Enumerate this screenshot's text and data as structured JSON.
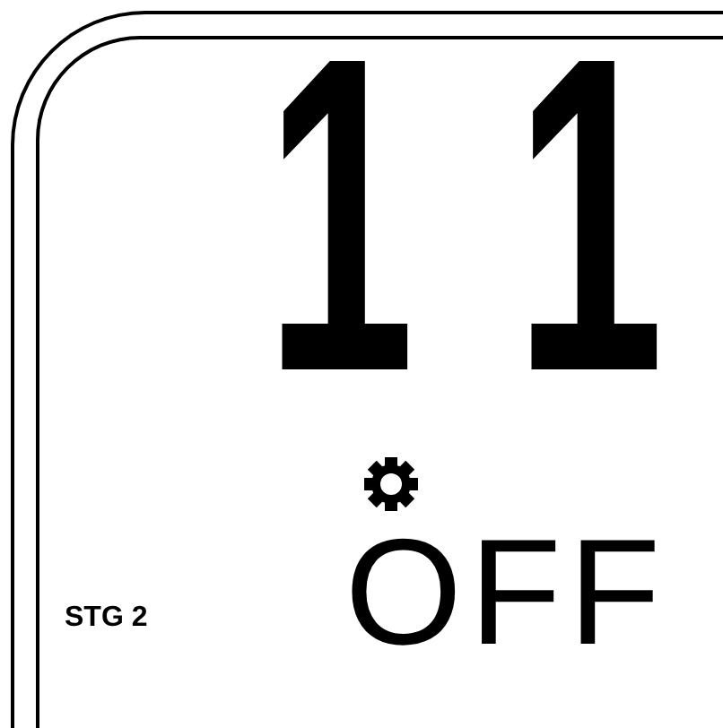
{
  "display": {
    "digits": [
      "1",
      "1"
    ],
    "stage_label": "STG 2",
    "status": "OFF"
  }
}
